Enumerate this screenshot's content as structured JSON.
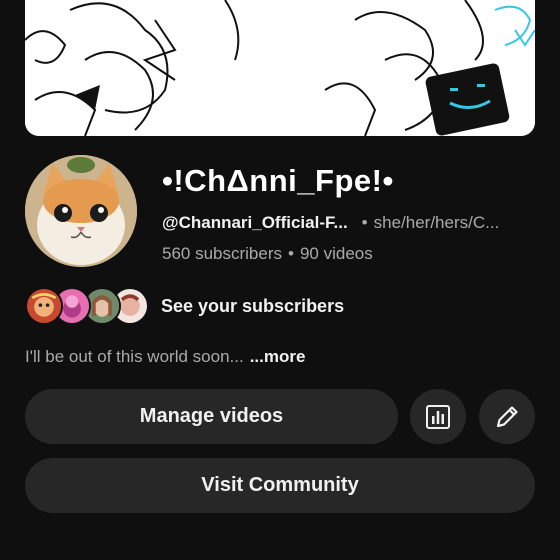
{
  "channel": {
    "name": "•!ChΔnni_Fpe!•",
    "handle": "@Channari_Official-F...",
    "pronouns": "she/her/hers/C...",
    "subscribers": "560 subscribers",
    "videos": "90 videos"
  },
  "subscribers_preview": {
    "label": "See your subscribers",
    "avatar_count": 4
  },
  "description": {
    "text": "I'll be out of this world soon...",
    "more_label": "...more"
  },
  "actions": {
    "manage_videos_label": "Manage videos",
    "analytics_icon": "analytics-icon",
    "edit_icon": "pencil-icon",
    "visit_community_label": "Visit Community"
  },
  "colors": {
    "background": "#0f0f0f",
    "button": "#272727",
    "secondary_text": "#aaaaaa",
    "banner_accent": "#39c6e6"
  }
}
